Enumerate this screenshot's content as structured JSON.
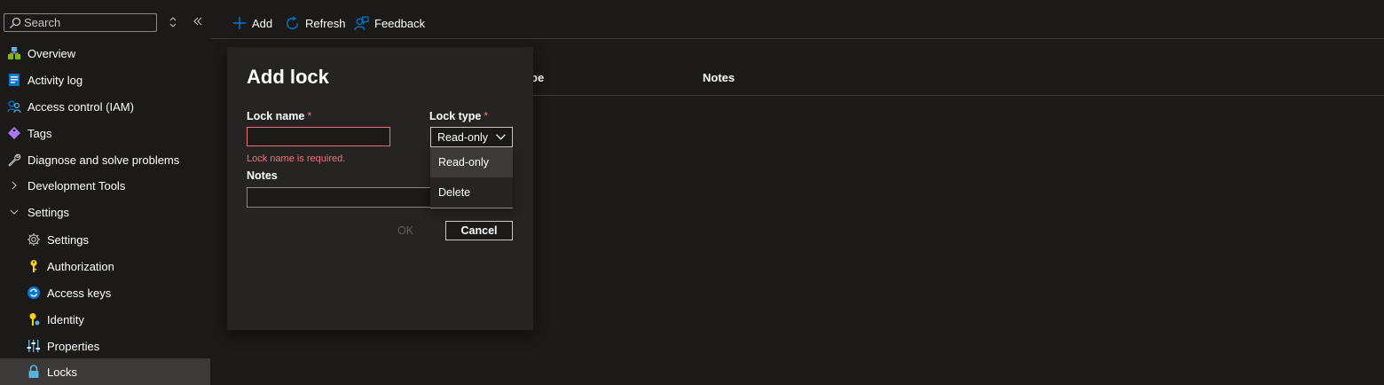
{
  "sidebar": {
    "search_placeholder": "Search",
    "sort_icon": "up-down-arrows-icon",
    "collapse_icon": "double-chevron-left-icon",
    "items": [
      {
        "label": "Overview",
        "icon": "overview-icon"
      },
      {
        "label": "Activity log",
        "icon": "activity-log-icon"
      },
      {
        "label": "Access control (IAM)",
        "icon": "people-icon"
      },
      {
        "label": "Tags",
        "icon": "tag-icon"
      },
      {
        "label": "Diagnose and solve problems",
        "icon": "wrench-icon"
      },
      {
        "label": "Development Tools",
        "icon": "chevron-right-icon"
      },
      {
        "label": "Settings",
        "icon": "chevron-down-icon"
      },
      {
        "label": "Settings",
        "icon": "gear-icon"
      },
      {
        "label": "Authorization",
        "icon": "key-icon"
      },
      {
        "label": "Access keys",
        "icon": "access-keys-icon"
      },
      {
        "label": "Identity",
        "icon": "identity-key-icon"
      },
      {
        "label": "Properties",
        "icon": "properties-icon"
      },
      {
        "label": "Locks",
        "icon": "lock-icon",
        "selected": true
      }
    ]
  },
  "toolbar": {
    "add_label": "Add",
    "refresh_label": "Refresh",
    "feedback_label": "Feedback"
  },
  "table": {
    "columns": [
      "pe",
      "Notes"
    ]
  },
  "dialog": {
    "title": "Add lock",
    "lock_name_label": "Lock name",
    "required_mark": "*",
    "lock_name_value": "",
    "lock_name_error": "Lock name is required.",
    "lock_type_label": "Lock type",
    "lock_type_selected": "Read-only",
    "lock_type_options": [
      "Read-only",
      "Delete"
    ],
    "notes_label": "Notes",
    "notes_value": "",
    "ok_label": "OK",
    "cancel_label": "Cancel"
  },
  "colors": {
    "background": "#1b1a19",
    "accent": "#0078d4",
    "error": "#f1707b",
    "selected_row": "#3b3a39"
  }
}
